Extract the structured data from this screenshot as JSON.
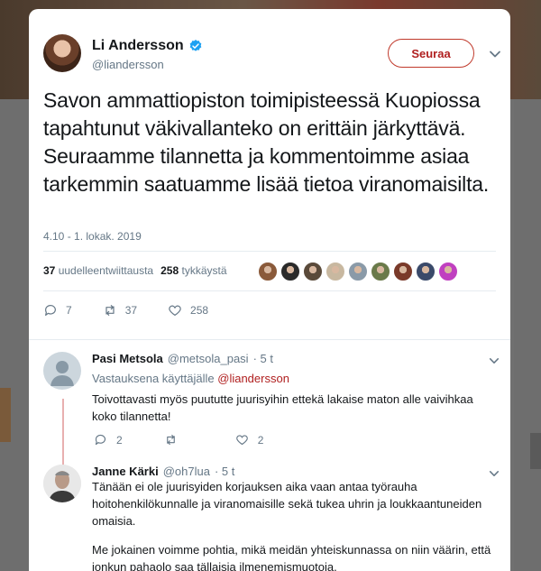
{
  "tweet": {
    "author_name": "Li Andersson",
    "author_handle": "@liandersson",
    "follow_label": "Seuraa",
    "text": "Savon ammattiopiston toimipisteessä Kuopiossa tapahtunut väkivallanteko on erittäin järkyttävä. Seuraamme tilannetta ja kommentoimme asiaa tarkemmin saatuamme lisää tietoa viranomaisilta.",
    "timestamp": "4.10 - 1. lokak. 2019",
    "retweets_count": "37",
    "retweets_label": "uudelleentwiittausta",
    "likes_count": "258",
    "likes_label": "tykkäystä",
    "actions": {
      "replies": "7",
      "retweets": "37",
      "likes": "258"
    }
  },
  "replies": [
    {
      "name": "Pasi Metsola",
      "handle": "@metsola_pasi",
      "time": "· 5 t",
      "replying_prefix": "Vastauksena käyttäjälle",
      "replying_to": "@liandersson",
      "text": "Toivottavasti myös puututte juurisyihin ettekä lakaise maton alle vaivihkaa koko tilannetta!",
      "actions": {
        "replies": "2",
        "retweets": "",
        "likes": "2"
      }
    },
    {
      "name": "Janne Kärki",
      "handle": "@oh7lua",
      "time": "· 5 t",
      "text": "Tänään ei ole juurisyiden korjauksen aika vaan antaa työrauha hoitohenkilökunnalle ja viranomaisille sekä tukea uhrin ja loukkaantuneiden omaisia.",
      "text2": "Me jokainen voimme pohtia, mikä meidän yhteiskunnassa on niin väärin, että jonkun pahaolo saa tällaisia ilmenemismuotoja."
    }
  ],
  "colors": {
    "accent": "#b02020",
    "verified": "#1da1f2",
    "muted": "#657786"
  },
  "likers": [
    "#8a5a3a",
    "#2a2a2a",
    "#5a4a3a",
    "#c8b8a0",
    "#8a9aa8",
    "#6a7a4a",
    "#7a3a2a",
    "#3a4a6a",
    "#c040c0"
  ]
}
